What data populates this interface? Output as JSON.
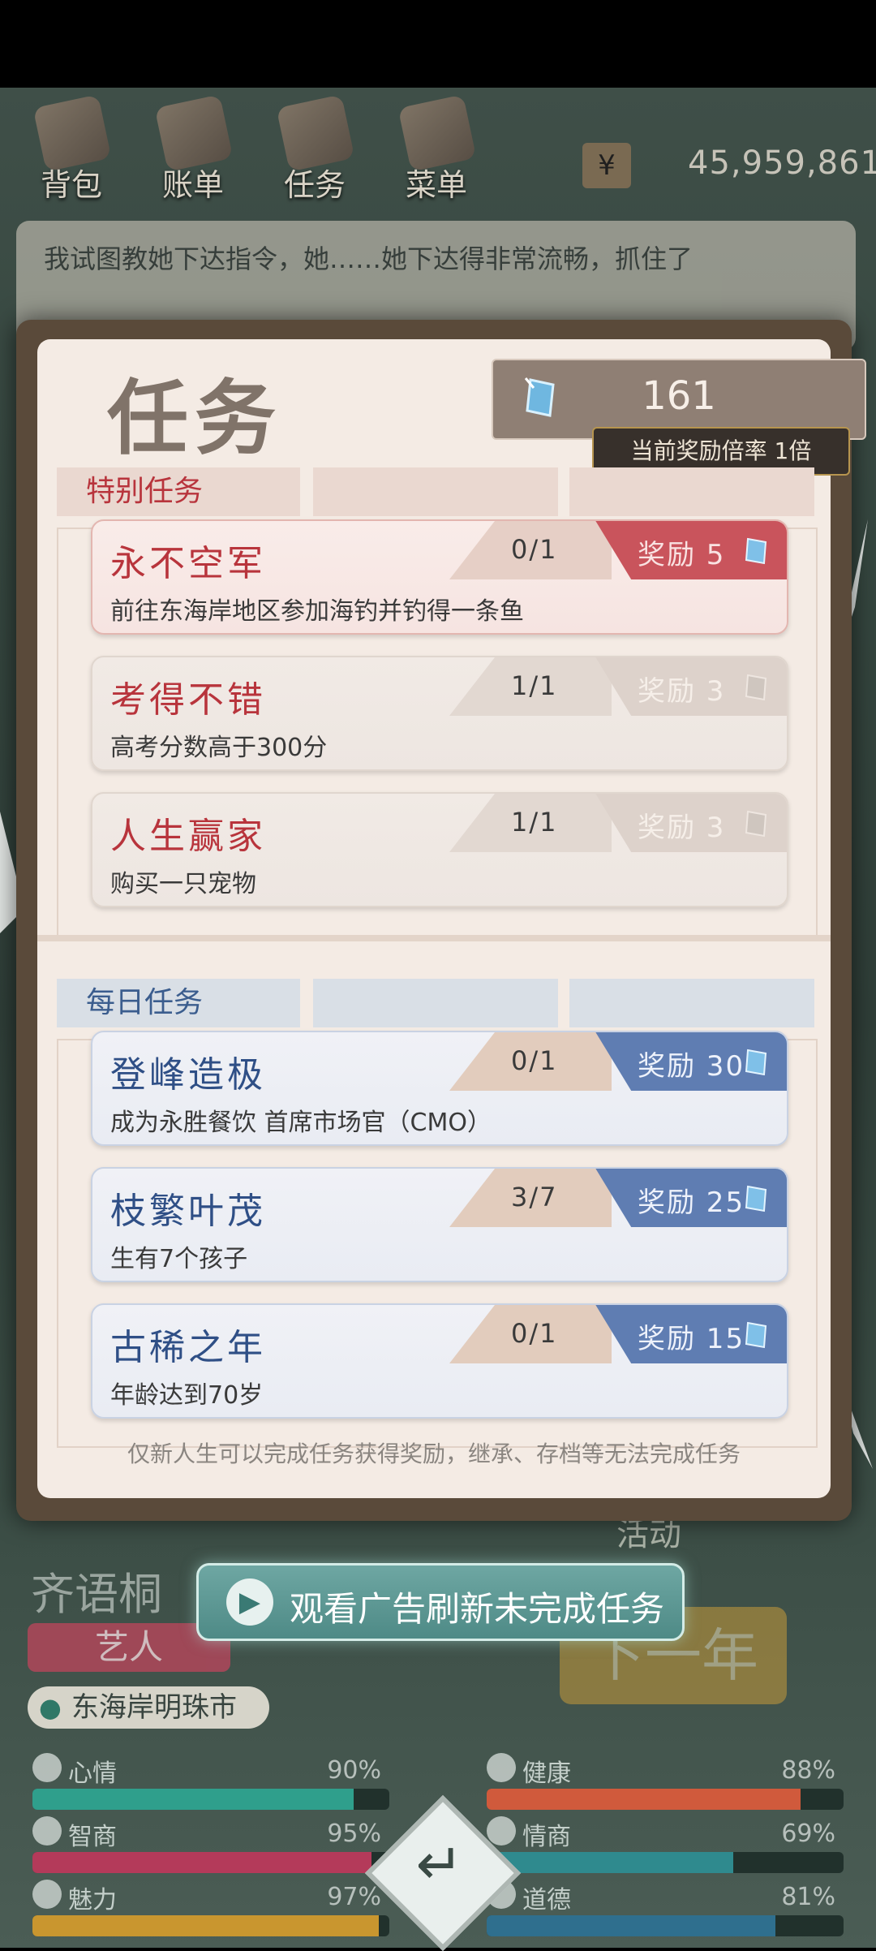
{
  "topnav": {
    "items": [
      {
        "label": "背包",
        "icon": "backpack-icon"
      },
      {
        "label": "账单",
        "icon": "bill-icon"
      },
      {
        "label": "任务",
        "icon": "task-icon"
      },
      {
        "label": "菜单",
        "icon": "menu-icon"
      }
    ],
    "money": {
      "symbol": "¥",
      "value": "45,959,861"
    }
  },
  "story": {
    "line": "我试图教她下达指令，她……她下达得非常流畅，抓住了"
  },
  "dialog": {
    "title": "任务",
    "gems": "161",
    "reward_rate": "当前奖励倍率 1倍",
    "special": {
      "header": "特别任务",
      "tasks": [
        {
          "name": "永不空军",
          "desc": "前往东海岸地区参加海钓并钓得一条鱼",
          "progress": "0/1",
          "reward": "奖励 5",
          "state": "active"
        },
        {
          "name": "考得不错",
          "desc": "高考分数高于300分",
          "progress": "1/1",
          "reward": "奖励 3",
          "state": "done"
        },
        {
          "name": "人生赢家",
          "desc": "购买一只宠物",
          "progress": "1/1",
          "reward": "奖励 3",
          "state": "done"
        }
      ]
    },
    "daily": {
      "header": "每日任务",
      "tasks": [
        {
          "name": "登峰造极",
          "desc": "成为永胜餐饮 首席市场官（CMO）",
          "progress": "0/1",
          "reward": "奖励 30"
        },
        {
          "name": "枝繁叶茂",
          "desc": "生有7个孩子",
          "progress": "3/7",
          "reward": "奖励 25"
        },
        {
          "name": "古稀之年",
          "desc": "年龄达到70岁",
          "progress": "0/1",
          "reward": "奖励 15"
        }
      ]
    },
    "note": "仅新人生可以完成任务获得奖励，继承、存档等无法完成任务"
  },
  "ad_button": {
    "label": "观看广告刷新未完成任务"
  },
  "character": {
    "name": "齐语桐",
    "role": "艺人",
    "location": "东海岸明珠市",
    "activity": "活动",
    "next_year": "下一年"
  },
  "stats": [
    {
      "name": "心情",
      "pct": "90%",
      "value": 0.9,
      "color": "#2f9f8c",
      "icon": "smile-icon"
    },
    {
      "name": "健康",
      "pct": "88%",
      "value": 0.88,
      "color": "#d05a3c",
      "icon": "heart-icon"
    },
    {
      "name": "智商",
      "pct": "95%",
      "value": 0.95,
      "color": "#b43a5a",
      "icon": "bulb-icon"
    },
    {
      "name": "情商",
      "pct": "69%",
      "value": 0.69,
      "color": "#2f8a8e",
      "icon": "apple-icon"
    },
    {
      "name": "魅力",
      "pct": "97%",
      "value": 0.97,
      "color": "#c9962f",
      "icon": "star-icon"
    },
    {
      "name": "道德",
      "pct": "81%",
      "value": 0.81,
      "color": "#2f6f8e",
      "icon": "scale-icon"
    }
  ],
  "colors": {
    "special_accent": "#c9545c",
    "daily_accent": "#5f7db2",
    "ad_button": "#5a9692"
  }
}
